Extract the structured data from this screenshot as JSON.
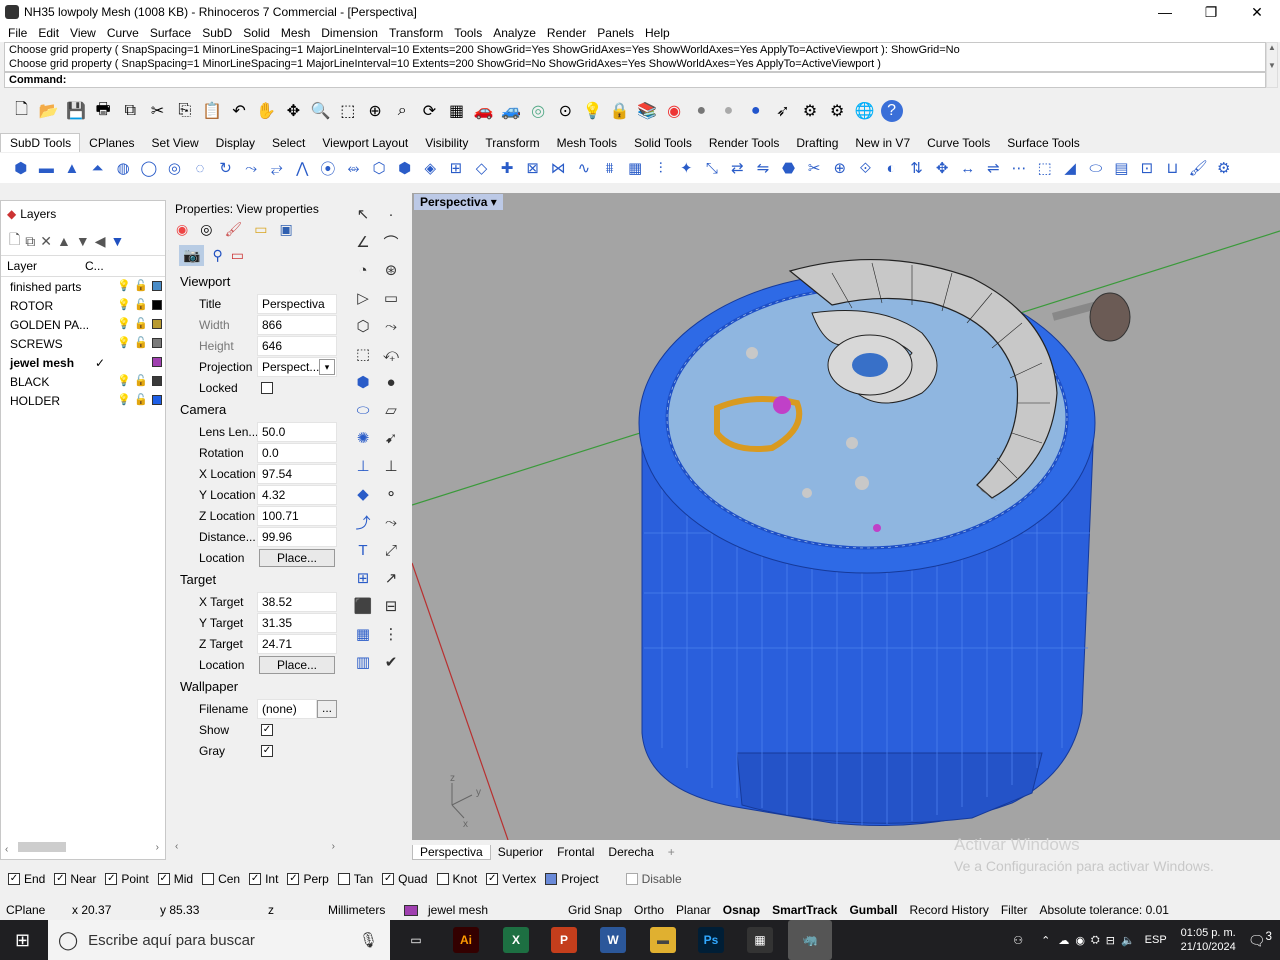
{
  "window": {
    "title": "NH35 lowpoly Mesh (1008 KB) - Rhinoceros 7 Commercial - [Perspectiva]",
    "minimize": "—",
    "maximize": "❐",
    "close": "✕"
  },
  "menu": [
    "File",
    "Edit",
    "View",
    "Curve",
    "Surface",
    "SubD",
    "Solid",
    "Mesh",
    "Dimension",
    "Transform",
    "Tools",
    "Analyze",
    "Render",
    "Panels",
    "Help"
  ],
  "command": {
    "history": [
      "Choose grid property ( SnapSpacing=1  MinorLineSpacing=1  MajorLineInterval=10  Extents=200  ShowGrid=Yes  ShowGridAxes=Yes  ShowWorldAxes=Yes  ApplyTo=ActiveViewport ): ShowGrid=No",
      "Choose grid property ( SnapSpacing=1  MinorLineSpacing=1  MajorLineInterval=10  Extents=200  ShowGrid=No  ShowGridAxes=Yes  ShowWorldAxes=Yes  ApplyTo=ActiveViewport )"
    ],
    "prompt": "Command:"
  },
  "main_toolbar_icons": [
    "new-icon",
    "open-icon",
    "save-icon",
    "print-icon",
    "import-icon",
    "cut-icon",
    "copy-icon",
    "paste-icon",
    "undo-icon",
    "pan-icon",
    "move-icon",
    "zoom-icon",
    "zoom-window-icon",
    "zoom-extents-icon",
    "zoom-selected-icon",
    "rotate-view-icon",
    "grid-icon",
    "car-icon",
    "car2-icon",
    "osnap-icon",
    "target-icon",
    "light-icon",
    "lock-icon",
    "layer-icon",
    "color-wheel-icon",
    "sphere-gray-icon",
    "sphere-silver-icon",
    "sphere-blue-icon",
    "cursor-icon",
    "gear-icon",
    "gears-icon",
    "globe-icon",
    "help-icon"
  ],
  "tabs": [
    "SubD Tools",
    "CPlanes",
    "Set View",
    "Display",
    "Select",
    "Viewport Layout",
    "Visibility",
    "Transform",
    "Mesh Tools",
    "Solid Tools",
    "Render Tools",
    "Drafting",
    "New in V7",
    "Curve Tools",
    "Surface Tools"
  ],
  "active_tab": "SubD Tools",
  "layers": {
    "title": "Layers",
    "col_layer": "Layer",
    "col_c": "C...",
    "rows": [
      {
        "name": "finished parts",
        "color": "#4a8cc7",
        "current": false
      },
      {
        "name": "ROTOR",
        "color": "#000000",
        "current": false
      },
      {
        "name": "GOLDEN PA...",
        "color": "#b89a30",
        "current": false
      },
      {
        "name": "SCREWS",
        "color": "#7a7a7a",
        "current": false
      },
      {
        "name": "jewel mesh",
        "color": "#a040b0",
        "current": true
      },
      {
        "name": "BLACK",
        "color": "#3a3a3a",
        "current": false
      },
      {
        "name": "HOLDER",
        "color": "#1e5fe6",
        "current": false
      }
    ],
    "check": "✓"
  },
  "properties": {
    "title": "Properties: View properties",
    "viewport_section": "Viewport",
    "title_label": "Title",
    "title_value": "Perspectiva",
    "width_label": "Width",
    "width_value": "866",
    "height_label": "Height",
    "height_value": "646",
    "projection_label": "Projection",
    "projection_value": "Perspect...",
    "locked_label": "Locked",
    "camera_section": "Camera",
    "lens_label": "Lens Len...",
    "lens_value": "50.0",
    "rotation_label": "Rotation",
    "rotation_value": "0.0",
    "xloc_label": "X Location",
    "xloc_value": "97.54",
    "yloc_label": "Y Location",
    "yloc_value": "4.32",
    "zloc_label": "Z Location",
    "zloc_value": "100.71",
    "dist_label": "Distance...",
    "dist_value": "99.96",
    "loc_label": "Location",
    "place_btn": "Place...",
    "target_section": "Target",
    "xt_label": "X Target",
    "xt_value": "38.52",
    "yt_label": "Y Target",
    "yt_value": "31.35",
    "zt_label": "Z Target",
    "zt_value": "24.71",
    "wallpaper_section": "Wallpaper",
    "fn_label": "Filename",
    "fn_value": "(none)",
    "fn_btn": "...",
    "show_label": "Show",
    "gray_label": "Gray",
    "check": "✓"
  },
  "viewport": {
    "name": "Perspectiva",
    "tabs": [
      "Perspectiva",
      "Superior",
      "Frontal",
      "Derecha"
    ],
    "add": "+"
  },
  "activate": {
    "line1": "Activar Windows",
    "line2": "Ve a Configuración para activar Windows."
  },
  "osnaps": [
    {
      "label": "End",
      "on": true
    },
    {
      "label": "Near",
      "on": true
    },
    {
      "label": "Point",
      "on": true
    },
    {
      "label": "Mid",
      "on": true
    },
    {
      "label": "Cen",
      "on": false
    },
    {
      "label": "Int",
      "on": true
    },
    {
      "label": "Perp",
      "on": true
    },
    {
      "label": "Tan",
      "on": false
    },
    {
      "label": "Quad",
      "on": true
    },
    {
      "label": "Knot",
      "on": false
    },
    {
      "label": "Vertex",
      "on": true
    },
    {
      "label": "Project",
      "on": false
    },
    {
      "label": "Disable",
      "on": false
    }
  ],
  "status": {
    "cplane": "CPlane",
    "x": "x 20.37",
    "y": "y 85.33",
    "z": "z",
    "units": "Millimeters",
    "layer": "jewel mesh",
    "layer_color": "#a040b0",
    "grid_snap": "Grid Snap",
    "ortho": "Ortho",
    "planar": "Planar",
    "osnap": "Osnap",
    "smarttrack": "SmartTrack",
    "gumball": "Gumball",
    "record": "Record History",
    "filter": "Filter",
    "tolerance": "Absolute tolerance: 0.01"
  },
  "taskbar": {
    "search": "Escribe aquí para buscar",
    "lang": "ESP",
    "time": "01:05 p. m.",
    "date": "21/10/2024",
    "notif": "3"
  },
  "colors": {
    "accent": "#1e5fe6",
    "viewport_bg": "#a4a4a4"
  }
}
